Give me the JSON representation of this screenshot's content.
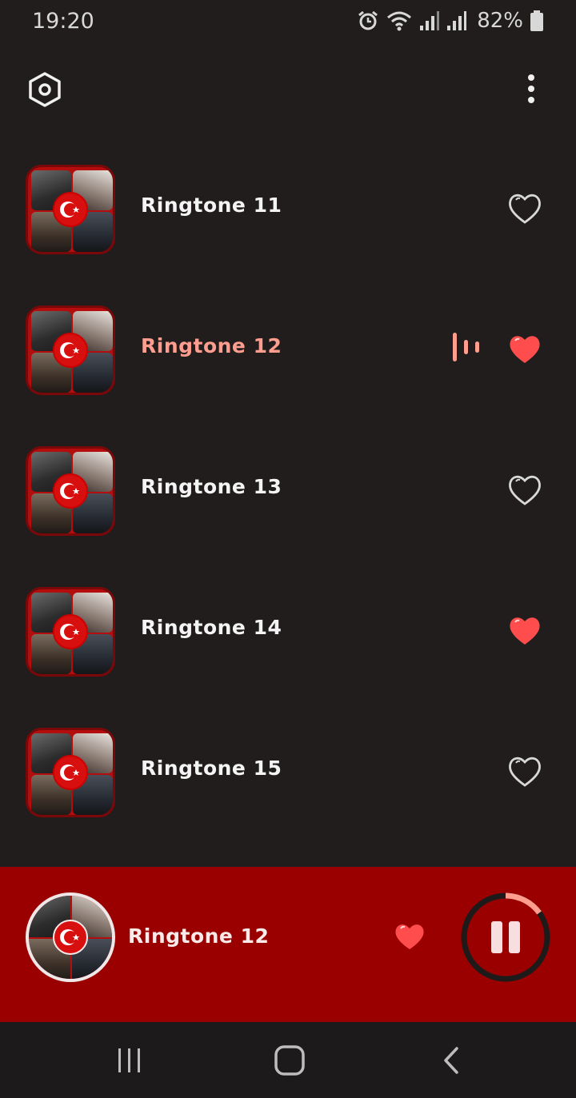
{
  "status_bar": {
    "time": "19:20",
    "battery": "82%",
    "icons": [
      "alarm-icon",
      "wifi-icon",
      "signal-icon",
      "signal-icon",
      "battery-icon"
    ]
  },
  "app_bar": {
    "left_icon": "settings-icon",
    "right_icon": "more-vert-icon"
  },
  "ringtones": [
    {
      "title": "Ringtone 11",
      "favorite": false,
      "playing": false
    },
    {
      "title": "Ringtone 12",
      "favorite": true,
      "playing": true
    },
    {
      "title": "Ringtone 13",
      "favorite": false,
      "playing": false
    },
    {
      "title": "Ringtone 14",
      "favorite": true,
      "playing": false
    },
    {
      "title": "Ringtone 15",
      "favorite": false,
      "playing": false
    }
  ],
  "player": {
    "title": "Ringtone 12",
    "favorite": true,
    "state": "playing",
    "progress": 0.15
  },
  "colors": {
    "background": "#211d1d",
    "accent_text": "#ff9e8f",
    "heart": "#ff4d4d",
    "player_bg": "#9a0000"
  },
  "nav_bar": {
    "icons": [
      "recents-icon",
      "home-icon",
      "back-icon"
    ]
  }
}
